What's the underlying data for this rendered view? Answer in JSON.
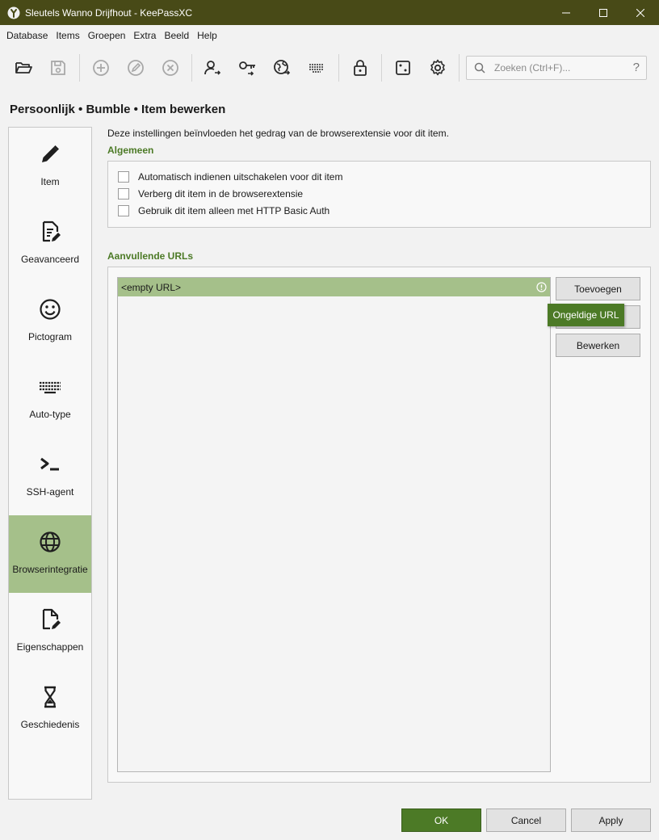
{
  "window": {
    "title": "Sleutels Wanno Drijfhout - KeePassXC",
    "brand_color": "#484a17",
    "accent_color": "#4c7a26",
    "selection_color": "#a5c08a"
  },
  "menubar": {
    "items": [
      "Database",
      "Items",
      "Groepen",
      "Extra",
      "Beeld",
      "Help"
    ]
  },
  "toolbar": {
    "icons": [
      "folder-open-icon",
      "save-icon",
      "add-entry-icon",
      "edit-entry-icon",
      "delete-entry-icon",
      "copy-username-icon",
      "copy-password-icon",
      "open-url-icon",
      "auto-type-icon",
      "lock-icon",
      "password-generator-icon",
      "settings-icon"
    ]
  },
  "search": {
    "placeholder": "Zoeken (Ctrl+F)...",
    "help": "?"
  },
  "page": {
    "title": "Persoonlijk • Bumble • Item bewerken"
  },
  "sidebar": {
    "items": [
      {
        "label": "Item",
        "icon": "pencil-icon"
      },
      {
        "label": "Geavanceerd",
        "icon": "document-edit-icon"
      },
      {
        "label": "Pictogram",
        "icon": "smiley-icon"
      },
      {
        "label": "Auto-type",
        "icon": "keyboard-icon"
      },
      {
        "label": "SSH-agent",
        "icon": "terminal-icon"
      },
      {
        "label": "Browserintegratie",
        "icon": "globe-icon",
        "selected": true
      },
      {
        "label": "Eigenschappen",
        "icon": "file-edit-icon"
      },
      {
        "label": "Geschiedenis",
        "icon": "hourglass-icon"
      }
    ]
  },
  "browser": {
    "description": "Deze instellingen beïnvloeden het gedrag van de browserextensie voor dit item.",
    "general_title": "Algemeen",
    "options": [
      {
        "label": "Automatisch indienen uitschakelen voor dit item",
        "checked": false
      },
      {
        "label": "Verberg dit item in de browserextensie",
        "checked": false
      },
      {
        "label": "Gebruik dit item alleen met HTTP Basic Auth",
        "checked": false
      }
    ],
    "urls_title": "Aanvullende URLs",
    "urls": [
      "<empty URL>"
    ],
    "add_label": "Toevoegen",
    "remove_label": "",
    "edit_label": "Bewerken",
    "tooltip": "Ongeldige URL"
  },
  "dialog": {
    "ok_label": "OK",
    "cancel_label": "Cancel",
    "apply_label": "Apply"
  }
}
